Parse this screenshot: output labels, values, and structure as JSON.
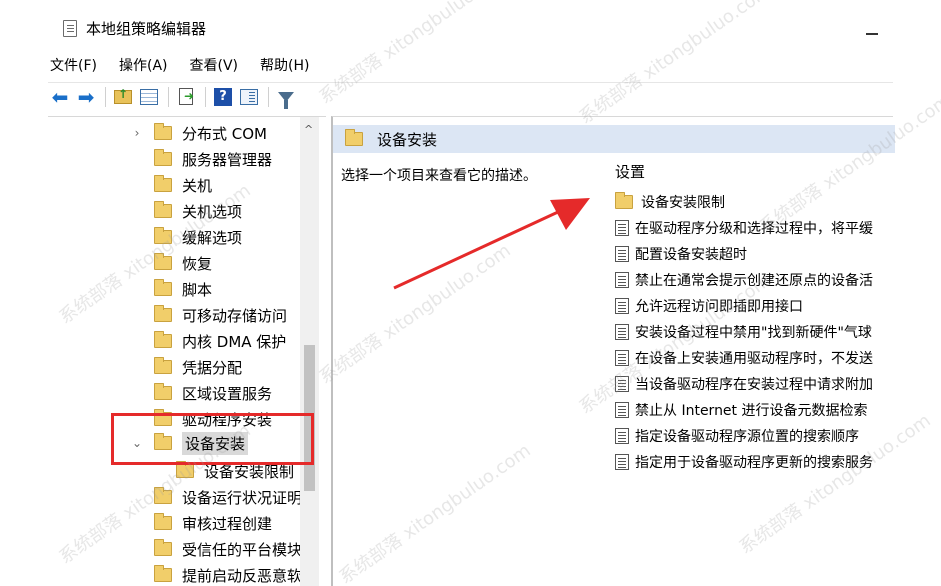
{
  "window": {
    "title": "本地组策略编辑器"
  },
  "menu": [
    {
      "label": "文件(F)"
    },
    {
      "label": "操作(A)"
    },
    {
      "label": "查看(V)"
    },
    {
      "label": "帮助(H)"
    }
  ],
  "toolbar": {
    "icons": [
      "back-arrow-icon",
      "forward-arrow-icon",
      "up-folder-icon",
      "show-hide-tree-icon",
      "export-list-icon",
      "help-icon",
      "extended-view-icon",
      "filter-icon"
    ]
  },
  "tree": {
    "items": [
      {
        "label": "分布式 COM",
        "expander": "›"
      },
      {
        "label": "服务器管理器",
        "expander": ""
      },
      {
        "label": "关机",
        "expander": ""
      },
      {
        "label": "关机选项",
        "expander": ""
      },
      {
        "label": "缓解选项",
        "expander": ""
      },
      {
        "label": "恢复",
        "expander": ""
      },
      {
        "label": "脚本",
        "expander": ""
      },
      {
        "label": "可移动存储访问",
        "expander": ""
      },
      {
        "label": "内核 DMA 保护",
        "expander": ""
      },
      {
        "label": "凭据分配",
        "expander": ""
      },
      {
        "label": "区域设置服务",
        "expander": ""
      },
      {
        "label": "驱动程序安装",
        "expander": ""
      },
      {
        "label": "设备安装",
        "expander": "⌄"
      },
      {
        "label": "设备安装限制",
        "expander": ""
      },
      {
        "label": "设备运行状况证明",
        "expander": ""
      },
      {
        "label": "审核过程创建",
        "expander": ""
      },
      {
        "label": "受信任的平台模块",
        "expander": ""
      },
      {
        "label": "提前启动反恶意软",
        "expander": ""
      }
    ],
    "scroll_up_glyph": "^"
  },
  "right_pane": {
    "header": "设备安装",
    "description": "选择一个项目来查看它的描述。",
    "settings_header": "设置",
    "settings": [
      {
        "label": "设备安装限制",
        "kind": "folder"
      },
      {
        "label": "在驱动程序分级和选择过程中，将平缓",
        "kind": "policy"
      },
      {
        "label": "配置设备安装超时",
        "kind": "policy"
      },
      {
        "label": "禁止在通常会提示创建还原点的设备活",
        "kind": "policy"
      },
      {
        "label": "允许远程访问即插即用接口",
        "kind": "policy"
      },
      {
        "label": "安装设备过程中禁用\"找到新硬件\"气球",
        "kind": "policy"
      },
      {
        "label": "在设备上安装通用驱动程序时，不发送",
        "kind": "policy"
      },
      {
        "label": "当设备驱动程序在安装过程中请求附加",
        "kind": "policy"
      },
      {
        "label": "禁止从 Internet 进行设备元数据检索",
        "kind": "policy"
      },
      {
        "label": "指定设备驱动程序源位置的搜索顺序",
        "kind": "policy"
      },
      {
        "label": "指定用于设备驱动程序更新的搜索服务",
        "kind": "policy"
      }
    ]
  },
  "annotation": {
    "highlight_color": "#e52a2a",
    "arrow_color": "#e52a2a"
  },
  "watermark": {
    "text": "系统部落 xitongbuluo.com"
  }
}
